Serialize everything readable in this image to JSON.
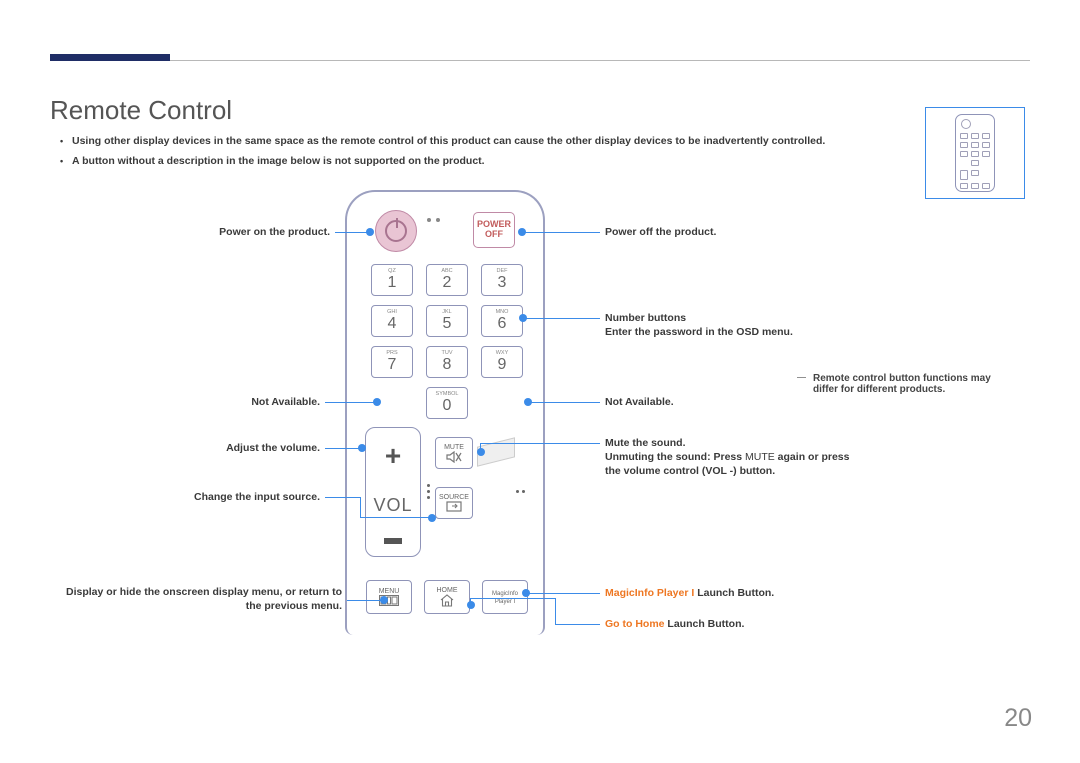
{
  "title": "Remote Control",
  "notes": [
    "Using other display devices in the same space as the remote control of this product can cause the other display devices to be inadvertently controlled.",
    "A button without a description in the image below is not supported on the product."
  ],
  "left": {
    "powerOn": "Power on the product.",
    "notAvail": "Not Available.",
    "volume": "Adjust the volume.",
    "source": "Change the input source.",
    "menu": "Display or hide the onscreen display menu, or return to the previous menu."
  },
  "right": {
    "powerOff": "Power off the product.",
    "numBtns": "Number buttons",
    "numBtns2": "Enter the password in the OSD menu.",
    "notAvail": "Not Available.",
    "mute1": "Mute the sound.",
    "mute2a": "Unmuting the sound: Press ",
    "mute2b": "MUTE",
    "mute2c": " again or press the volume control (",
    "mute2d": "VOL -",
    "mute2e": ") button.",
    "magicA": "MagicInfo Player I",
    "magicB": " Launch Button.",
    "homeA": "Go to Home",
    "homeB": " Launch Button."
  },
  "keys": {
    "k1s": "QZ",
    "k1": "1",
    "k2s": "ABC",
    "k2": "2",
    "k3s": "DEF",
    "k3": "3",
    "k4s": "GHI",
    "k4": "4",
    "k5s": "JKL",
    "k5": "5",
    "k6s": "MNO",
    "k6": "6",
    "k7s": "PRS",
    "k7": "7",
    "k8s": "TUV",
    "k8": "8",
    "k9s": "WXY",
    "k9": "9",
    "k0s": "SYMBOL",
    "k0": "0",
    "powerOff1": "POWER",
    "powerOff2": "OFF",
    "vol": "VOL",
    "mute": "MUTE",
    "source": "SOURCE",
    "menu": "MENU",
    "home": "HOME",
    "magic1": "MagicInfo",
    "magic2": "Player I"
  },
  "sidenote": "Remote control button functions may differ for different products.",
  "pageNumber": "20"
}
